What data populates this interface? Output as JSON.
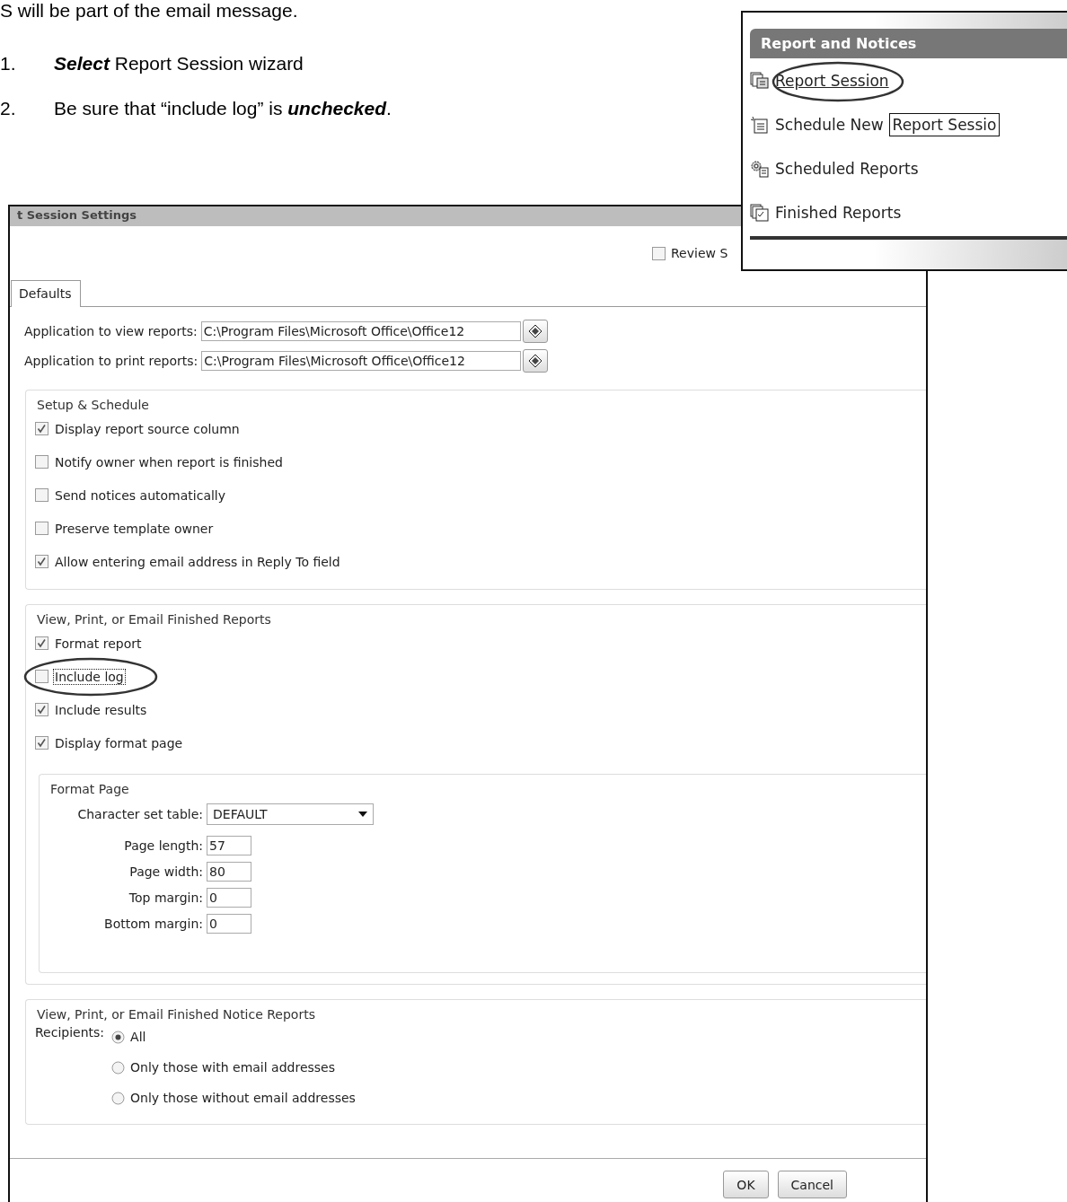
{
  "document": {
    "intro_line": "S will be part of the email message.",
    "steps": [
      {
        "number": "1.",
        "emphasis": "Select",
        "after": " Report Session wizard"
      },
      {
        "number": "2.",
        "emphasis": "unchecked",
        "before": "Be sure that “include log” is ",
        "after": "."
      }
    ]
  },
  "dialog": {
    "title": "t Session Settings",
    "review_option": {
      "label": "Review S",
      "checked": false
    },
    "tabs": [
      {
        "label": "Defaults",
        "selected": true
      }
    ],
    "app_fields": [
      {
        "label": "Application to view reports:",
        "value": "C:\\Program Files\\Microsoft Office\\Office12"
      },
      {
        "label": "Application to print reports:",
        "value": "C:\\Program Files\\Microsoft Office\\Office12"
      }
    ],
    "sections": [
      {
        "kind": "checks",
        "title": "Setup & Schedule",
        "options": [
          {
            "label": "Display report source column",
            "checked": true,
            "focused": false
          },
          {
            "label": "Notify owner when report is finished",
            "checked": false,
            "focused": false
          },
          {
            "label": "Send notices automatically",
            "checked": false,
            "focused": false
          },
          {
            "label": "Preserve template owner",
            "checked": false,
            "focused": false
          },
          {
            "label": "Allow entering email address in Reply To field",
            "checked": true,
            "focused": false
          }
        ]
      },
      {
        "kind": "checks",
        "title": "View, Print, or Email Finished Reports",
        "options": [
          {
            "label": "Format report",
            "checked": true,
            "focused": false
          },
          {
            "label": "Include log",
            "checked": false,
            "focused": true
          },
          {
            "label": "Include results",
            "checked": true,
            "focused": false
          },
          {
            "label": "Display format page",
            "checked": true,
            "focused": false
          }
        ],
        "subsection": {
          "title": "Format Page",
          "fields": [
            {
              "kind": "select",
              "label": "Character set table:",
              "value": "DEFAULT"
            },
            {
              "kind": "text",
              "label": "Page length:",
              "value": "57"
            },
            {
              "kind": "text",
              "label": "Page width:",
              "value": "80"
            },
            {
              "kind": "text",
              "label": "Top margin:",
              "value": "0"
            },
            {
              "kind": "text",
              "label": "Bottom margin:",
              "value": "0"
            }
          ]
        }
      },
      {
        "kind": "radios",
        "title": "View, Print, or Email Finished Notice Reports",
        "label": "Recipients:",
        "options": [
          {
            "label": "All",
            "selected": true
          },
          {
            "label": "Only those with email addresses",
            "selected": false
          },
          {
            "label": "Only those without email addresses",
            "selected": false
          }
        ]
      }
    ],
    "buttons": [
      "OK",
      "Cancel"
    ]
  },
  "panel": {
    "title": "Report and Notices",
    "items": [
      {
        "kind": "session",
        "label": "Report Session",
        "hovered": true
      },
      {
        "kind": "schedule",
        "label": "Schedule New",
        "hovered": false
      },
      {
        "kind": "scheduled",
        "label": "Scheduled Reports",
        "hovered": false
      },
      {
        "kind": "finished",
        "label": "Finished Reports",
        "hovered": false
      }
    ],
    "tooltip": "Report Sessio"
  }
}
